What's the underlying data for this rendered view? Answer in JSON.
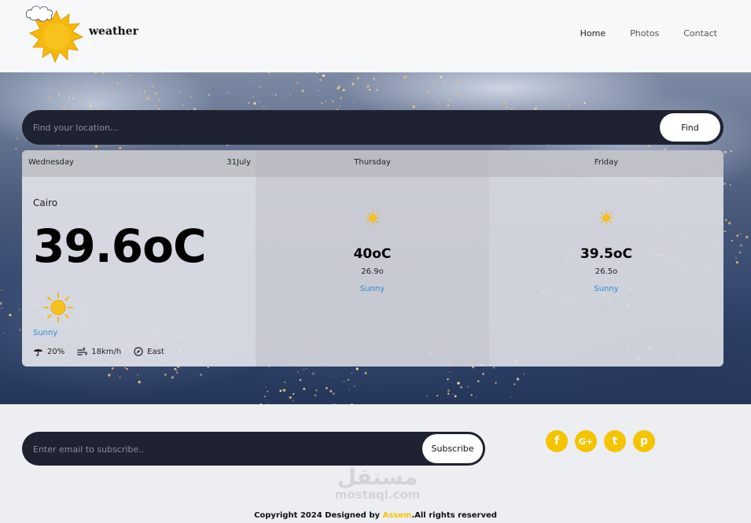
{
  "header": {
    "brand": "weather",
    "nav": [
      {
        "label": "Home",
        "active": true
      },
      {
        "label": "Photos",
        "active": false
      },
      {
        "label": "Contact",
        "active": false
      }
    ]
  },
  "search": {
    "placeholder": "Find your location...",
    "button_label": "Find"
  },
  "today": {
    "day": "Wednesday",
    "date": "31July",
    "city": "Cairo",
    "temperature": "39.6oC",
    "icon": "sun-icon",
    "condition": "Sunny",
    "stats": [
      {
        "icon": "umbrella-icon",
        "value": "20%"
      },
      {
        "icon": "wind-icon",
        "value": "18km/h"
      },
      {
        "icon": "compass-icon",
        "value": "East"
      }
    ]
  },
  "forecast": [
    {
      "day": "Thursday",
      "icon": "sun-icon",
      "max": "40oC",
      "min": "26.9o",
      "condition": "Sunny"
    },
    {
      "day": "Friday",
      "icon": "sun-icon",
      "max": "39.5oC",
      "min": "26.5o",
      "condition": "Sunny"
    }
  ],
  "footer": {
    "subscribe_placeholder": "Enter email to subscribe..",
    "subscribe_label": "Subscribe",
    "socials": [
      {
        "name": "facebook-icon",
        "glyph": "f"
      },
      {
        "name": "google-plus-icon",
        "glyph": "G+"
      },
      {
        "name": "twitter-icon",
        "glyph": "t"
      },
      {
        "name": "pinterest-icon",
        "glyph": "p"
      }
    ],
    "watermark_arabic": "مستقل",
    "watermark_latin": "mostaql.com",
    "copyright_prefix": "Copyright 2024 Designed by ",
    "copyright_author": "Assem",
    "copyright_suffix": ".All rights reserved"
  },
  "colors": {
    "accent": "#f5c400",
    "link": "#2d8fd0",
    "dark_bar": "#1f2230"
  }
}
